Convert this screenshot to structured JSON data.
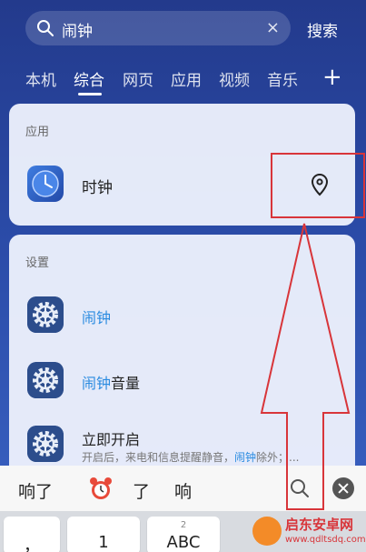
{
  "search": {
    "query": "闹钟",
    "clear_symbol": "×",
    "search_button": "搜索"
  },
  "tabs": [
    {
      "label": "本机"
    },
    {
      "label": "综合"
    },
    {
      "label": "网页"
    },
    {
      "label": "应用"
    },
    {
      "label": "视频"
    },
    {
      "label": "音乐"
    }
  ],
  "tabs_plus": "+",
  "apps_section": {
    "title": "应用",
    "items": [
      {
        "label": "时钟"
      }
    ]
  },
  "settings_section": {
    "title": "设置",
    "items": [
      {
        "highlight": "闹钟",
        "rest": ""
      },
      {
        "highlight": "闹钟",
        "rest": "音量"
      },
      {
        "title": "立即开启",
        "sub_prefix": "开启后，来电和信息提醒静音，",
        "sub_highlight": "闹钟",
        "sub_suffix": "除外；..."
      }
    ]
  },
  "suggestions": [
    "响了",
    "了",
    "响"
  ],
  "keyboard": {
    "keys": [
      {
        "main": "，",
        "sub": ""
      },
      {
        "main": "1",
        "sub": ""
      },
      {
        "main": "ABC",
        "sub": "2"
      }
    ]
  },
  "watermark": {
    "brand": "启东安卓网",
    "url": "www.qdltsdq.com"
  },
  "colors": {
    "background": "#2a4aa6",
    "highlight": "#2a8be0",
    "annotation": "#d8353a"
  }
}
